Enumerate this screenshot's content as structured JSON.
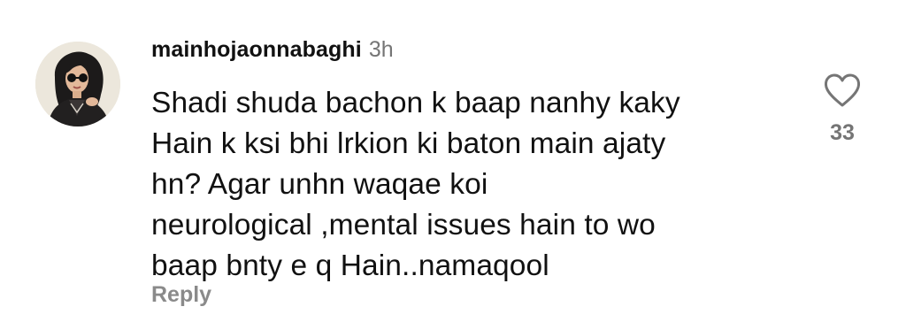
{
  "comment": {
    "avatar_icon": "profile-photo-avatar",
    "username": "mainhojaonnabaghi",
    "time": "3h",
    "text_lines": [
      "Shadi shuda bachon k baap nanhy kaky",
      "Hain k ksi bhi lrkion ki baton main ajaty",
      "hn? Agar unhn waqae koi",
      "neurological ,mental issues hain to wo",
      "baap bnty e q Hain..namaqool"
    ],
    "reply_label": "Reply",
    "like_icon": "heart-outline-icon",
    "like_count": "33"
  },
  "colors": {
    "text_primary": "#111111",
    "text_secondary": "#757575",
    "reply": "#8a8a8a",
    "background": "#ffffff"
  }
}
